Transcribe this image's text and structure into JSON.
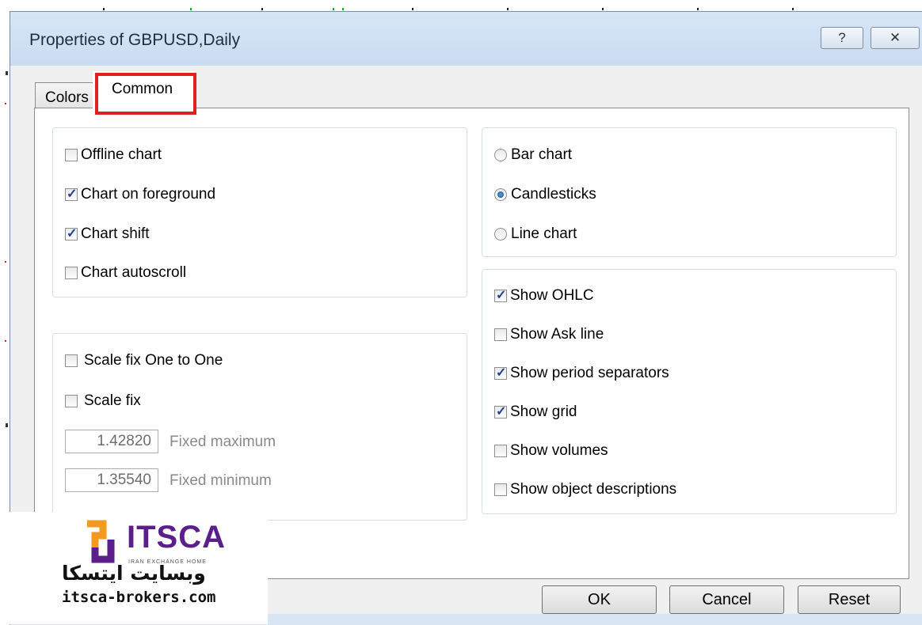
{
  "window": {
    "title": "Properties of GBPUSD,Daily",
    "help_glyph": "?",
    "close_glyph": "✕"
  },
  "tabs": [
    {
      "label": "Colors",
      "selected": false
    },
    {
      "label": "Common",
      "selected": true
    }
  ],
  "chart_options": {
    "offline_chart": {
      "label": "Offline chart",
      "checked": false
    },
    "chart_on_foreground": {
      "label": "Chart on foreground",
      "checked": true
    },
    "chart_shift": {
      "label": "Chart shift",
      "checked": true
    },
    "chart_autoscroll": {
      "label": "Chart autoscroll",
      "checked": false
    }
  },
  "chart_type": {
    "bar_chart": {
      "label": "Bar chart",
      "selected": false
    },
    "candlesticks": {
      "label": "Candlesticks",
      "selected": true
    },
    "line_chart": {
      "label": "Line chart",
      "selected": false
    }
  },
  "scale": {
    "scale_fix_one_to_one": {
      "label": "Scale fix One to One",
      "checked": false
    },
    "scale_fix": {
      "label": "Scale fix",
      "checked": false
    },
    "fixed_maximum": {
      "value": "1.42820",
      "label": "Fixed maximum"
    },
    "fixed_minimum": {
      "value": "1.35540",
      "label": "Fixed minimum"
    }
  },
  "show_options": {
    "show_ohlc": {
      "label": "Show OHLC",
      "checked": true
    },
    "show_ask_line": {
      "label": "Show Ask line",
      "checked": false
    },
    "show_period_separators": {
      "label": "Show period separators",
      "checked": true
    },
    "show_grid": {
      "label": "Show grid",
      "checked": true
    },
    "show_volumes": {
      "label": "Show volumes",
      "checked": false
    },
    "show_object_descriptions": {
      "label": "Show object descriptions",
      "checked": false
    }
  },
  "buttons": {
    "ok": "OK",
    "cancel": "Cancel",
    "reset": "Reset"
  },
  "watermark": {
    "brand": "ITSCA",
    "tagline": "IRAN EXCHANGE HOME",
    "persian": "وبسایت ایتسکا",
    "url": "itsca-brokers.com"
  },
  "colors": {
    "highlight": "#e02020",
    "title_bar": "#cfe0f3",
    "logo_purple": "#5b1f8c",
    "logo_orange": "#f29a1f"
  }
}
